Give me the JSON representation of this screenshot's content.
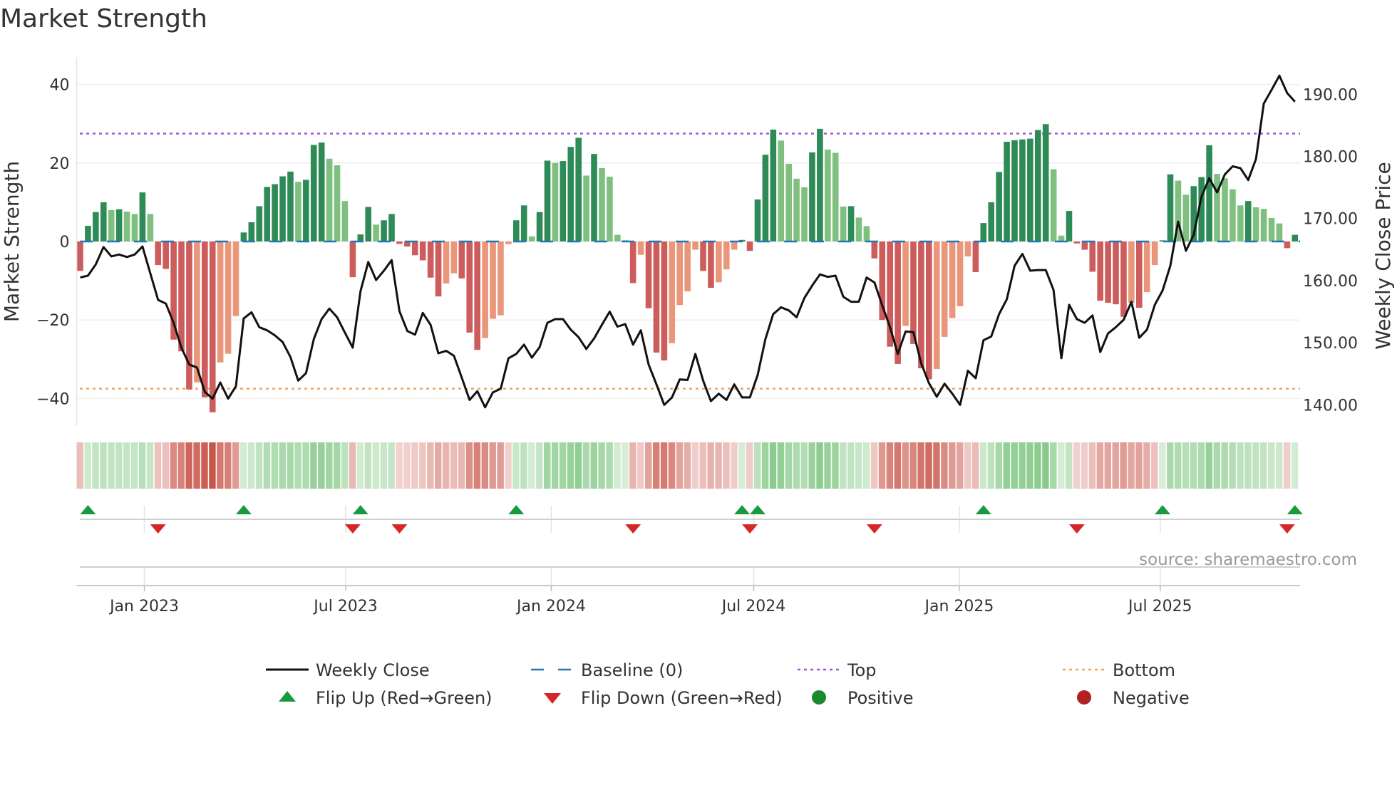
{
  "title": "Market Strength",
  "source": "source: sharemaestro.com",
  "colors": {
    "pos_strong": "#2e8b57",
    "pos_weak": "#7fbf7f",
    "neg_strong": "#cd5c5c",
    "neg_weak": "#e9967a",
    "close": "#111111",
    "baseline": "#1f77b4",
    "top": "#9b59d6",
    "bottom": "#f0a35e",
    "flip_up": "#1a9a3e",
    "flip_down": "#d62728",
    "positive": "#1a8a2e",
    "negative": "#b22222",
    "strip_green": "#4caf50",
    "strip_red": "#c0392b"
  },
  "chart_data": {
    "type": "bar+line",
    "title": "Market Strength",
    "ylabel": "Market Strength",
    "y2label": "Weekly Close Price",
    "ylim": [
      -47,
      47
    ],
    "y2lim": [
      136.6,
      196.0
    ],
    "yticks": [
      40,
      20,
      0,
      -20,
      -40
    ],
    "yticklabels": [
      "40",
      "20",
      "0",
      "−20",
      "−40"
    ],
    "y2ticks": [
      190,
      180,
      170,
      160,
      150,
      140
    ],
    "y2ticklabels": [
      "190.00",
      "180.00",
      "170.00",
      "160.00",
      "150.00",
      "140.00"
    ],
    "xticks": [
      {
        "label": "Jan 2023",
        "week": 8.24
      },
      {
        "label": "Jul 2023",
        "week": 34.1
      },
      {
        "label": "Jan 2024",
        "week": 60.5
      },
      {
        "label": "Jul 2024",
        "week": 86.5
      },
      {
        "label": "Jan 2025",
        "week": 112.9
      },
      {
        "label": "Jul 2025",
        "week": 138.7
      }
    ],
    "top_level": 27.5,
    "bottom_level": -37.5,
    "baseline": 0,
    "strength": [
      -7.5,
      4,
      7.5,
      10,
      8,
      8.2,
      7.6,
      7,
      12.5,
      7,
      -6,
      -7,
      -25,
      -28,
      -37.7,
      -35.9,
      -39.7,
      -43.5,
      -30.8,
      -28.6,
      -19,
      2.3,
      4.9,
      9,
      13.9,
      14.6,
      16.6,
      17.8,
      15.2,
      15.7,
      24.6,
      25.2,
      21.1,
      19.4,
      10.3,
      -9.1,
      1.8,
      8.8,
      4.3,
      5.4,
      7,
      -0.6,
      -1.3,
      -3.5,
      -4.8,
      -9.2,
      -14,
      -10.7,
      -8.1,
      -9.4,
      -23.2,
      -27.6,
      -24.6,
      -19.7,
      -18.8,
      -0.7,
      5.4,
      9.2,
      1.3,
      7.5,
      20.6,
      20,
      20.5,
      24.1,
      26.4,
      16.8,
      22.3,
      18.7,
      16.5,
      1.7,
      0.3,
      -10.6,
      -3.4,
      -17,
      -28.3,
      -30.3,
      -25.9,
      -16.2,
      -12.7,
      -2.1,
      -7.5,
      -11.8,
      -10.4,
      -7.1,
      -2.1,
      0.4,
      -2.4,
      10.7,
      22.1,
      28.5,
      25.7,
      19.8,
      16,
      13.8,
      22.7,
      28.7,
      23.4,
      22.6,
      8.9,
      9.0,
      6.1,
      3.9,
      -4.3,
      -20,
      -26.8,
      -31.2,
      -21.5,
      -26.1,
      -32.3,
      -35.1,
      -32.5,
      -24.3,
      -19.5,
      -16.5,
      -3.8,
      -7.8,
      4.7,
      10,
      17.7,
      25.4,
      25.8,
      26,
      26.2,
      28.4,
      29.9,
      18.4,
      1.5,
      7.8,
      -0.5,
      -2.1,
      -7.7,
      -15.1,
      -15.6,
      -16,
      -19.2,
      -15.6,
      -16.9,
      -12.9,
      -6,
      0.3,
      17.1,
      15.5,
      11.9,
      14.1,
      16.4,
      24.5,
      17.2,
      16.1,
      13.3,
      9.2,
      10.3,
      8.7,
      8.3,
      6,
      4.6,
      -1.7,
      1.7
    ],
    "close": [
      160.5,
      160.8,
      162.6,
      165.4,
      163.9,
      164.2,
      163.8,
      164.2,
      165.5,
      161.2,
      156.9,
      156.3,
      153.2,
      149.2,
      146.5,
      146.0,
      142.1,
      141.0,
      143.6,
      141.0,
      143.0,
      153.9,
      154.9,
      152.5,
      152.0,
      151.2,
      150.1,
      147.7,
      143.9,
      145.1,
      150.6,
      153.8,
      155.5,
      154.1,
      151.6,
      149.2,
      158.3,
      163.0,
      160.1,
      161.6,
      163.3,
      155.1,
      151.9,
      151.3,
      154.8,
      152.9,
      148.3,
      148.7,
      147.9,
      144.4,
      140.8,
      142.2,
      139.6,
      142.0,
      142.6,
      147.5,
      148.2,
      149.7,
      147.6,
      149.3,
      153.2,
      153.8,
      153.8,
      152.1,
      150.9,
      149.0,
      150.7,
      152.9,
      155.0,
      152.6,
      153.0,
      149.7,
      152.0,
      146.5,
      143.3,
      140.0,
      141.2,
      144.1,
      144.0,
      148.2,
      143.9,
      140.6,
      141.8,
      140.8,
      143.3,
      141.2,
      141.2,
      144.8,
      150.6,
      154.6,
      155.7,
      155.2,
      154.1,
      157.2,
      159.2,
      161.0,
      160.6,
      160.8,
      157.4,
      156.6,
      156.6,
      160.5,
      159.7,
      156.0,
      152.5,
      148.2,
      151.8,
      151.7,
      146.7,
      143.5,
      141.3,
      143.4,
      141.8,
      140.0,
      145.5,
      144.3,
      150.4,
      151.0,
      154.6,
      157.0,
      162.4,
      164.3,
      161.6,
      161.7,
      161.7,
      158.5,
      147.5,
      156.1,
      153.8,
      153.2,
      154.4,
      148.5,
      151.5,
      152.5,
      153.7,
      156.6,
      150.8,
      152.1,
      156.1,
      158.4,
      162.4,
      169.5,
      164.8,
      167.4,
      173.5,
      176.5,
      174.2,
      177.1,
      178.4,
      178.1,
      176.2,
      179.6,
      188.5,
      190.7,
      193.0,
      190.2,
      188.8
    ]
  },
  "legend": [
    {
      "label": "Weekly Close",
      "symbol": "line",
      "key": "close"
    },
    {
      "label": "Baseline (0)",
      "symbol": "dash",
      "key": "baseline"
    },
    {
      "label": "Top",
      "symbol": "dot",
      "key": "top"
    },
    {
      "label": "Bottom",
      "symbol": "dot",
      "key": "bottom"
    },
    {
      "label": "Flip Up (Red→Green)",
      "symbol": "tri-up",
      "key": "flip_up"
    },
    {
      "label": "Flip Down (Green→Red)",
      "symbol": "tri-down",
      "key": "flip_down"
    },
    {
      "label": "Positive",
      "symbol": "circle",
      "key": "positive"
    },
    {
      "label": "Negative",
      "symbol": "circle",
      "key": "negative"
    }
  ]
}
